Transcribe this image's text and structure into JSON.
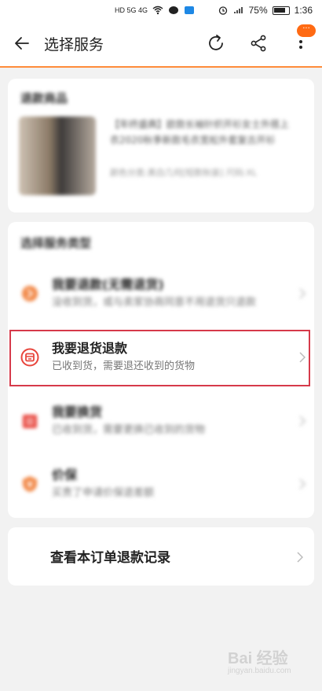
{
  "status_bar": {
    "left_indicators": "HD 5G 4G",
    "battery": "75%",
    "time": "1:36"
  },
  "header": {
    "title": "选择服务",
    "more_badge": "···"
  },
  "refund_item": {
    "section_title": "退款商品",
    "product_title": "【年终盛典】欧款长袖针织开衫女士外搭上衣2020秋季新款毛衣宽松外套复古开衫",
    "product_sub": "颜色分类:黑白几何[短款秋装] 尺码:XL"
  },
  "service_type": {
    "section_title": "选择服务类型",
    "options": [
      {
        "title": "我要退款(无需退货)",
        "desc": "没收到货，或与卖家协商同意不用退货只退款",
        "icon": "refund-only-icon"
      },
      {
        "title": "我要退货退款",
        "desc": "已收到货，需要退还收到的货物",
        "icon": "return-refund-icon"
      },
      {
        "title": "我要换货",
        "desc": "已收到货，需要更换已收到的货物",
        "icon": "exchange-icon"
      },
      {
        "title": "价保",
        "desc": "买贵了申请价保退差额",
        "icon": "price-protect-icon"
      }
    ]
  },
  "records": {
    "label": "查看本订单退款记录"
  },
  "watermark": {
    "brand": "Bai 经验",
    "sub": "jingyan.baidu.com"
  },
  "colors": {
    "accent": "#ff6a13",
    "divider": "#ff8c3a",
    "highlight_box": "#d63a4a",
    "option_icon": "#e8453c"
  }
}
